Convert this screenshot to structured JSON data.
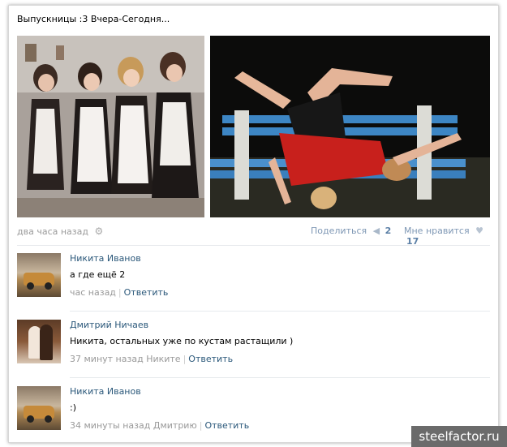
{
  "post": {
    "title": "Выпускницы :3 Вчера-Сегодня...",
    "time": "два часа назад",
    "share_label": "Поделиться",
    "share_count": "2",
    "like_label": "Мне нравится",
    "like_count": "17"
  },
  "comments": [
    {
      "author": "Никита Иванов",
      "text": "а где ещё 2",
      "time": "час назад",
      "reply_to": "",
      "reply_label": "Ответить",
      "avatar": "car-avatar"
    },
    {
      "author": "Дмитрий Ничаев",
      "text": "Никита, остальных уже по кустам растащили )",
      "time": "37 минут назад",
      "reply_to": "Никите",
      "reply_label": "Ответить",
      "avatar": "couple-avatar"
    },
    {
      "author": "Никита Иванов",
      "text": ":)",
      "time": "34 минуты назад",
      "reply_to": "Дмитрию",
      "reply_label": "Ответить",
      "avatar": "car-avatar"
    }
  ],
  "icons": {
    "settings": "gear-icon",
    "share": "megaphone-icon",
    "like": "heart-icon"
  },
  "colors": {
    "link": "#2b587a",
    "muted": "#999999",
    "count": "#5b7fa6"
  },
  "watermark": "steelfactor.ru"
}
